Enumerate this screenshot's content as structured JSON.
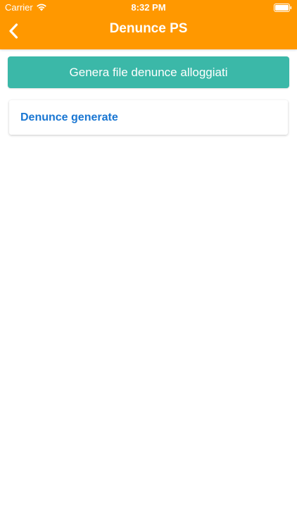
{
  "status_bar": {
    "carrier": "Carrier",
    "time": "8:32 PM",
    "wifi_icon": "wifi-icon",
    "battery_icon": "battery-icon"
  },
  "nav_bar": {
    "title": "Denunce PS",
    "back_icon": "chevron-left-icon",
    "background_color": "#FF9800"
  },
  "main": {
    "generate_button_label": "Genera file denunce alloggiati",
    "generate_button_color": "#3BB8A8",
    "list_items": [
      {
        "label": "Denunce generate",
        "color": "#1976D2"
      }
    ]
  }
}
